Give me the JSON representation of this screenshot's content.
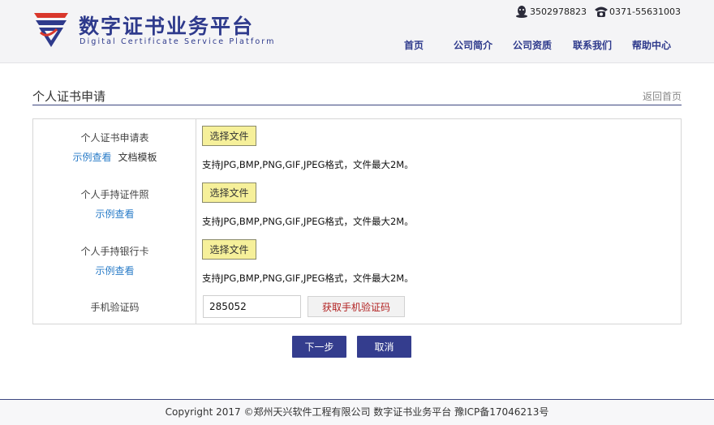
{
  "header": {
    "logo_title": "数字证书业务平台",
    "logo_subtitle": "Digital Certificate Service Platform",
    "qq": "3502978823",
    "phone": "0371-55631003",
    "nav": [
      "首页",
      "公司简介",
      "公司资质",
      "联系我们",
      "帮助中心"
    ]
  },
  "page": {
    "title": "个人证书申请",
    "back_link": "返回首页"
  },
  "form": {
    "rows": [
      {
        "label": "个人证书申请表",
        "link_example": "示例查看",
        "link_template": "文档模板",
        "button": "选择文件",
        "hint": "支持JPG,BMP,PNG,GIF,JPEG格式，文件最大2M。"
      },
      {
        "label": "个人手持证件照",
        "link_example": "示例查看",
        "button": "选择文件",
        "hint": "支持JPG,BMP,PNG,GIF,JPEG格式，文件最大2M。"
      },
      {
        "label": "个人手持银行卡",
        "link_example": "示例查看",
        "button": "选择文件",
        "hint": "支持JPG,BMP,PNG,GIF,JPEG格式，文件最大2M。"
      }
    ],
    "sms": {
      "label": "手机验证码",
      "value": "285052",
      "button": "获取手机验证码"
    }
  },
  "actions": {
    "next": "下一步",
    "cancel": "取消"
  },
  "footer": {
    "text": "Copyright 2017 ©郑州天兴软件工程有限公司 数字证书业务平台 豫ICP备17046213号"
  },
  "colors": {
    "brand": "#2e3a8c",
    "accent_red": "#d9372b",
    "button_primary": "#343d8e",
    "file_button": "#f6f09a",
    "link": "#2a7cc8"
  }
}
